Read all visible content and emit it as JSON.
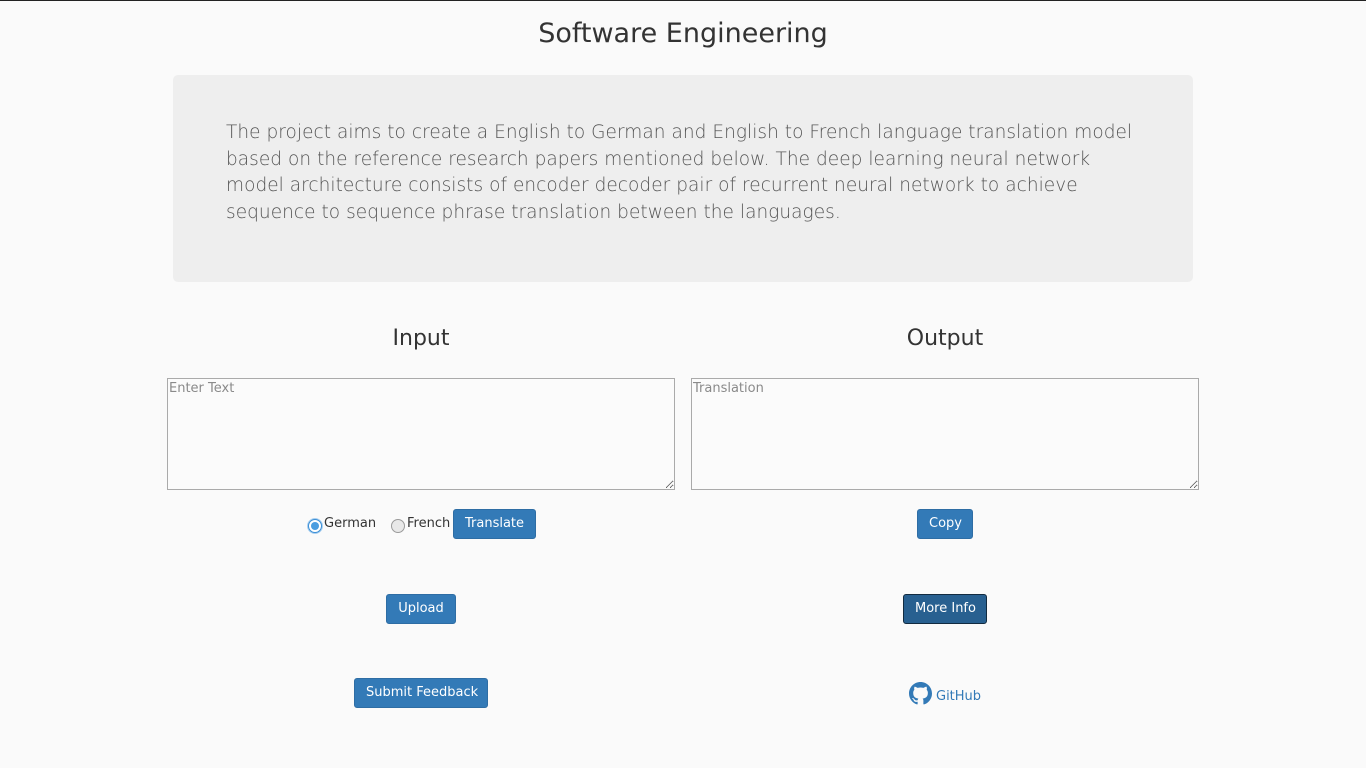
{
  "header": {
    "title": "Software Engineering"
  },
  "intro": {
    "text": "The project aims to create a English to German and English to French language translation model based on the reference research papers mentioned below. The deep learning neural network model architecture consists of encoder decoder pair of recurrent neural network to achieve sequence to sequence phrase translation between the languages."
  },
  "input": {
    "heading": "Input",
    "placeholder": "Enter Text",
    "value": "",
    "languages": [
      {
        "label": "German",
        "selected": true
      },
      {
        "label": "French",
        "selected": false
      }
    ],
    "translate_label": "Translate",
    "upload_label": "Upload",
    "feedback_label": "Submit Feedback"
  },
  "output": {
    "heading": "Output",
    "placeholder": "Translation",
    "value": "",
    "copy_label": "Copy",
    "more_info_label": "More Info",
    "github_label": "GitHub",
    "github_icon": "github-icon"
  },
  "colors": {
    "primary_button": "#337ab7",
    "primary_button_active": "#286090",
    "jumbotron_bg": "#eeeeee",
    "page_bg": "#fafafa"
  }
}
